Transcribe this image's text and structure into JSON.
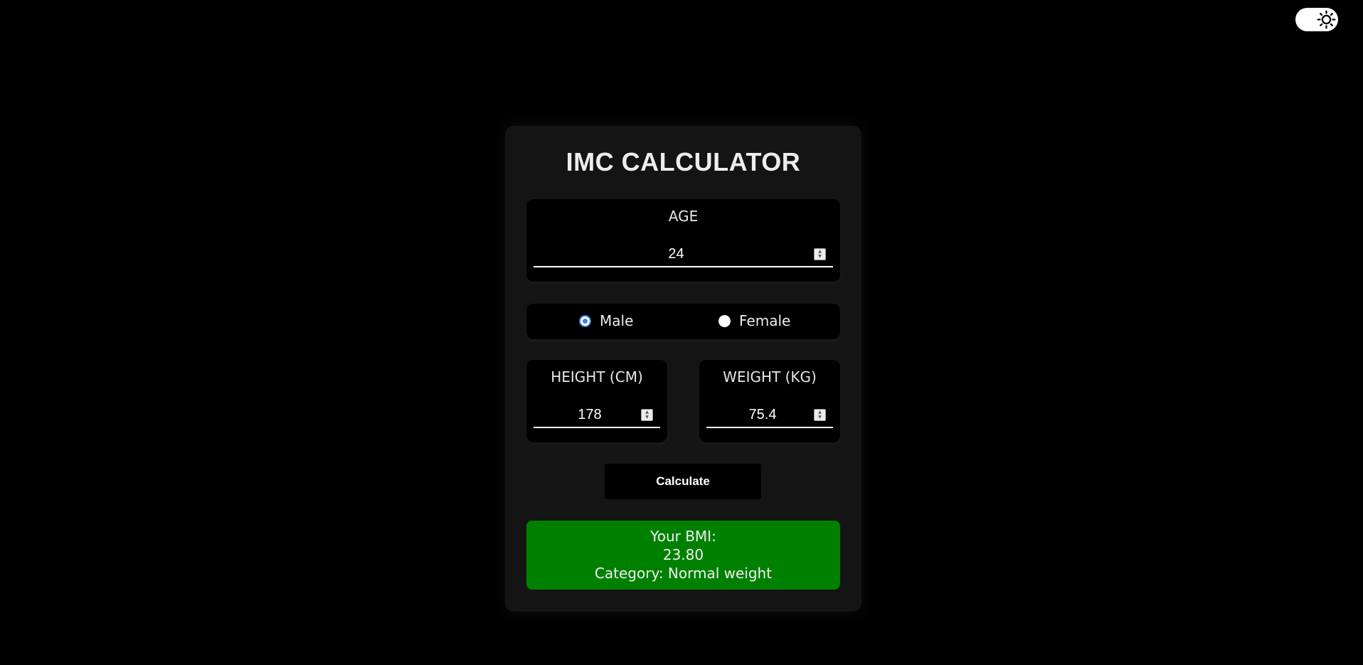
{
  "header": {
    "theme_icon": "sun-icon"
  },
  "calculator": {
    "title": "IMC CALCULATOR",
    "age": {
      "label": "AGE",
      "value": "24"
    },
    "gender": {
      "options": [
        {
          "label": "Male",
          "checked": true
        },
        {
          "label": "Female",
          "checked": false
        }
      ]
    },
    "height": {
      "label": "HEIGHT (CM)",
      "value": "178"
    },
    "weight": {
      "label": "WEIGHT (KG)",
      "value": "75.4"
    },
    "button_label": "Calculate",
    "result": {
      "bmi_label": "Your BMI:",
      "bmi_value": "23.80",
      "category": "Category: Normal weight",
      "background": "#008000"
    }
  }
}
